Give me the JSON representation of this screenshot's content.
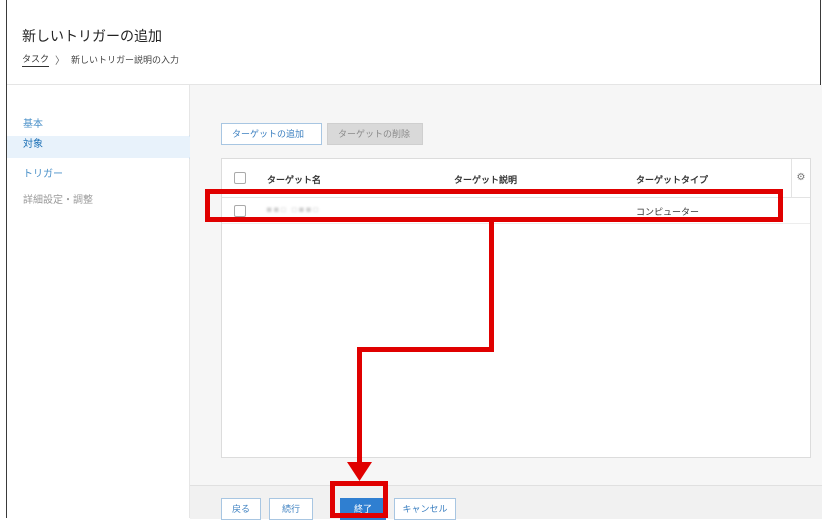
{
  "header": {
    "title": "新しいトリガーの追加",
    "breadcrumb": {
      "link": "タスク",
      "separator": "〉",
      "current": "新しいトリガー説明の入力"
    }
  },
  "sidebar": {
    "items": [
      {
        "label": "基本"
      },
      {
        "label": "対象"
      },
      {
        "label": "トリガー"
      },
      {
        "label": "詳細設定・調整"
      }
    ],
    "active_index": 1
  },
  "toolbar": {
    "add_label": "ターゲットの追加",
    "delete_label": "ターゲットの削除"
  },
  "table": {
    "columns": [
      "ターゲット名",
      "ターゲット説明",
      "ターゲットタイプ"
    ],
    "rows": [
      {
        "name": "",
        "description": "",
        "type": "コンピューター"
      }
    ],
    "settings_icon": "gear-icon"
  },
  "footer": {
    "back_label": "戻る",
    "next_label": "続行",
    "finish_label": "終了",
    "cancel_label": "キャンセル"
  },
  "colors": {
    "accent": "#2f7fd1",
    "annotation": "#e00000"
  }
}
